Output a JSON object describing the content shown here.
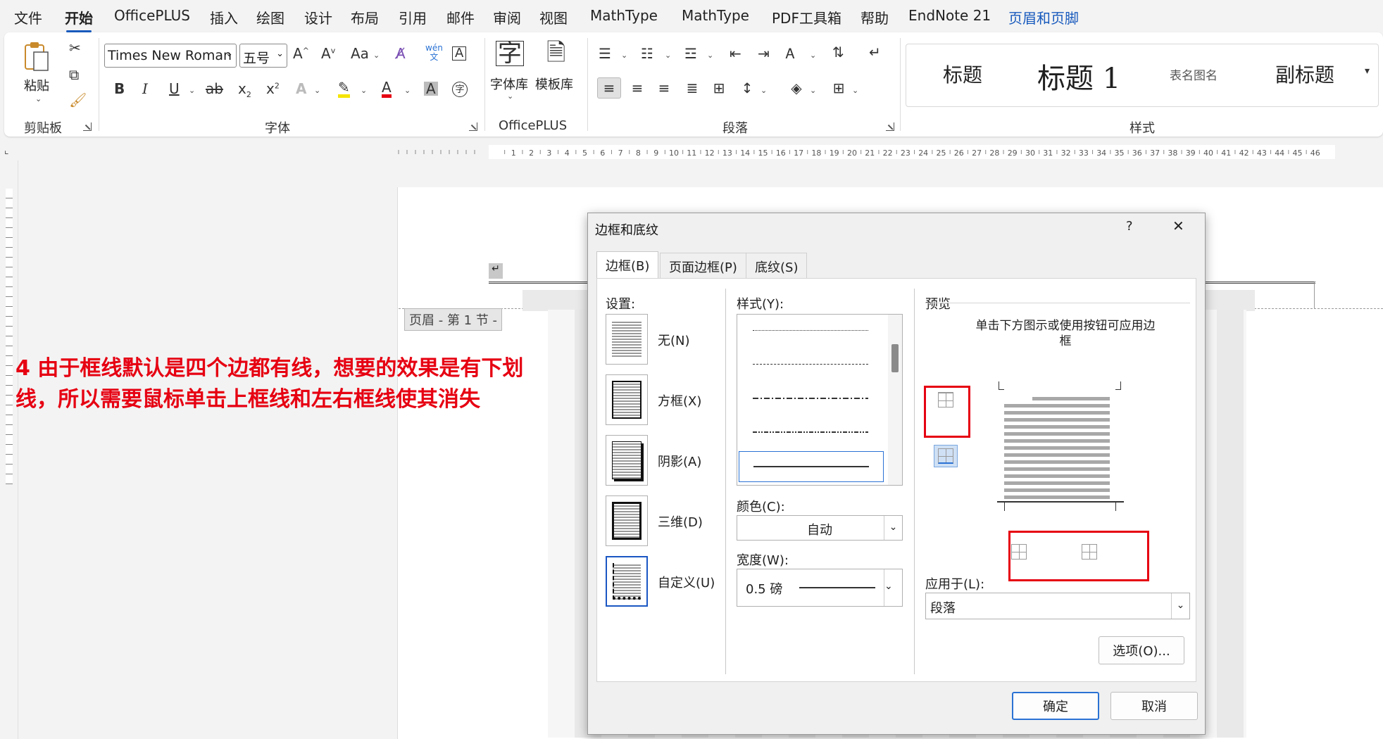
{
  "menubar": {
    "items": [
      {
        "label": "文件"
      },
      {
        "label": "开始"
      },
      {
        "label": "OfficePLUS"
      },
      {
        "label": "插入"
      },
      {
        "label": "绘图"
      },
      {
        "label": "设计"
      },
      {
        "label": "布局"
      },
      {
        "label": "引用"
      },
      {
        "label": "邮件"
      },
      {
        "label": "审阅"
      },
      {
        "label": "视图"
      },
      {
        "label": "MathType"
      },
      {
        "label": "MathType"
      },
      {
        "label": "PDF工具箱"
      },
      {
        "label": "帮助"
      },
      {
        "label": "EndNote 21"
      },
      {
        "label": "页眉和页脚"
      }
    ]
  },
  "ribbon": {
    "clipboard": {
      "paste_label": "粘贴",
      "group_label": "剪贴板"
    },
    "font": {
      "font_name": "Times New Roman",
      "font_size": "五号",
      "group_label": "字体"
    },
    "officeplus": {
      "font_lib_label": "字体库",
      "template_lib_label": "模板库",
      "group_label": "OfficePLUS"
    },
    "paragraph": {
      "group_label": "段落"
    },
    "styles": {
      "items": [
        {
          "label": "标题"
        },
        {
          "label": "标题 1"
        },
        {
          "label": "表名图名"
        },
        {
          "label": "副标题"
        }
      ],
      "group_label": "样式"
    }
  },
  "ruler": {
    "ticks": [
      "1",
      "2",
      "3",
      "4",
      "5",
      "6",
      "7",
      "8",
      "9",
      "10",
      "11",
      "12",
      "13",
      "14",
      "15",
      "16",
      "17",
      "18",
      "19",
      "20",
      "21",
      "22",
      "23",
      "24",
      "25",
      "26",
      "27",
      "28",
      "29",
      "30",
      "31",
      "32",
      "33",
      "34",
      "35",
      "36",
      "37",
      "38",
      "39",
      "40",
      "41",
      "42",
      "43",
      "44",
      "45",
      "46"
    ]
  },
  "document": {
    "header_tag": "页眉 - 第 1 节 -"
  },
  "annotation": {
    "text": "4 由于框线默认是四个边都有线，想要的效果是有下划线，所以需要鼠标单击上框线和左右框线使其消失"
  },
  "dialog": {
    "title": "边框和底纹",
    "help": "?",
    "close": "✕",
    "tabs": [
      {
        "label": "边框(B)"
      },
      {
        "label": "页面边框(P)"
      },
      {
        "label": "底纹(S)"
      }
    ],
    "settings_label": "设置:",
    "settings": [
      {
        "label": "无(N)"
      },
      {
        "label": "方框(X)"
      },
      {
        "label": "阴影(A)"
      },
      {
        "label": "三维(D)"
      },
      {
        "label": "自定义(U)"
      }
    ],
    "style_label": "样式(Y):",
    "color_label": "颜色(C):",
    "color_value": "自动",
    "width_label": "宽度(W):",
    "width_value": "0.5 磅",
    "preview_label": "预览",
    "preview_hint": "单击下方图示或使用按钮可应用边框",
    "apply_to_label": "应用于(L):",
    "apply_to_value": "段落",
    "options_button": "选项(O)...",
    "ok_button": "确定",
    "cancel_button": "取消"
  },
  "colors": {
    "accent": "#185abd",
    "annotation_red": "#e60012"
  }
}
